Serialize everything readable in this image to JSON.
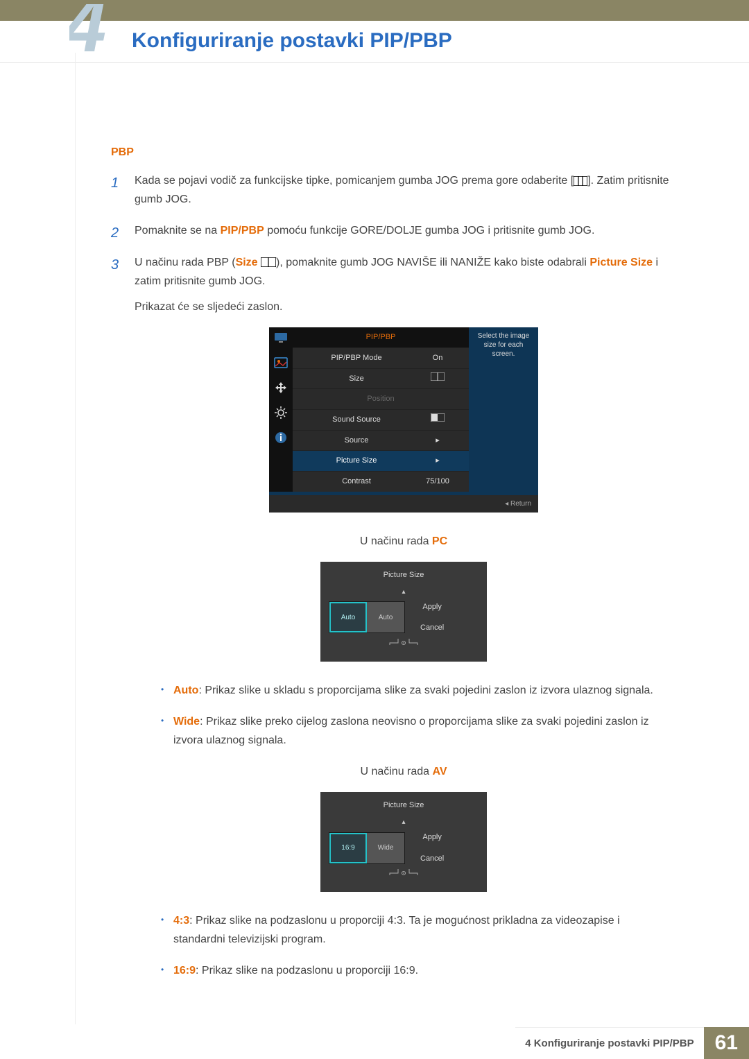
{
  "header": {
    "chapter_digit": "4",
    "title": "Konfiguriranje postavki PIP/PBP"
  },
  "section": {
    "heading": "PBP"
  },
  "steps": {
    "s1a": "Kada se pojavi vodič za funkcijske tipke, pomicanjem gumba JOG prema gore odaberite [",
    "s1b": "]. Zatim pritisnite gumb JOG.",
    "s2a": "Pomaknite se na ",
    "s2_key": "PIP/PBP",
    "s2b": " pomoću funkcije GORE/DOLJE gumba JOG i pritisnite gumb JOG.",
    "s3a": "U načinu rada PBP (",
    "s3_size": "Size",
    "s3b": " ",
    "s3c": "), pomaknite gumb JOG NAVIŠE ili NANIŽE kako biste odabrali ",
    "s3_ps": "Picture Size",
    "s3d": " i zatim pritisnite gumb JOG.",
    "s3e": "Prikazat će se sljedeći zaslon."
  },
  "osd": {
    "header": "PIP/PBP",
    "help": "Select the image size for each screen.",
    "rows": {
      "mode": {
        "label": "PIP/PBP Mode",
        "value": "On"
      },
      "size": {
        "label": "Size"
      },
      "position": {
        "label": "Position"
      },
      "sound": {
        "label": "Sound Source"
      },
      "source": {
        "label": "Source"
      },
      "psize": {
        "label": "Picture Size"
      },
      "contrast": {
        "label": "Contrast",
        "value": "75/100"
      }
    },
    "return": "Return"
  },
  "pc_caption_a": "U načinu rada ",
  "pc_caption_b": "PC",
  "av_caption_a": "U načinu rada ",
  "av_caption_b": "AV",
  "ps_pc": {
    "title": "Picture Size",
    "left": "Auto",
    "right": "Auto",
    "apply": "Apply",
    "cancel": "Cancel"
  },
  "ps_av": {
    "title": "Picture Size",
    "left": "16:9",
    "right": "Wide",
    "apply": "Apply",
    "cancel": "Cancel"
  },
  "bullets_pc": {
    "auto_k": "Auto",
    "auto_t": ": Prikaz slike u skladu s proporcijama slike za svaki pojedini zaslon iz izvora ulaznog signala.",
    "wide_k": "Wide",
    "wide_t": ": Prikaz slike preko cijelog zaslona neovisno o proporcijama slike za svaki pojedini zaslon iz izvora ulaznog signala."
  },
  "bullets_av": {
    "r43_k": "4:3",
    "r43_t": ": Prikaz slike na podzaslonu u proporciji 4:3. Ta je mogućnost prikladna za videozapise i standardni televizijski program.",
    "r169_k": "16:9",
    "r169_t": ": Prikaz slike na podzaslonu u proporciji 16:9."
  },
  "footer": {
    "label": "4 Konfiguriranje postavki PIP/PBP",
    "page": "61"
  }
}
